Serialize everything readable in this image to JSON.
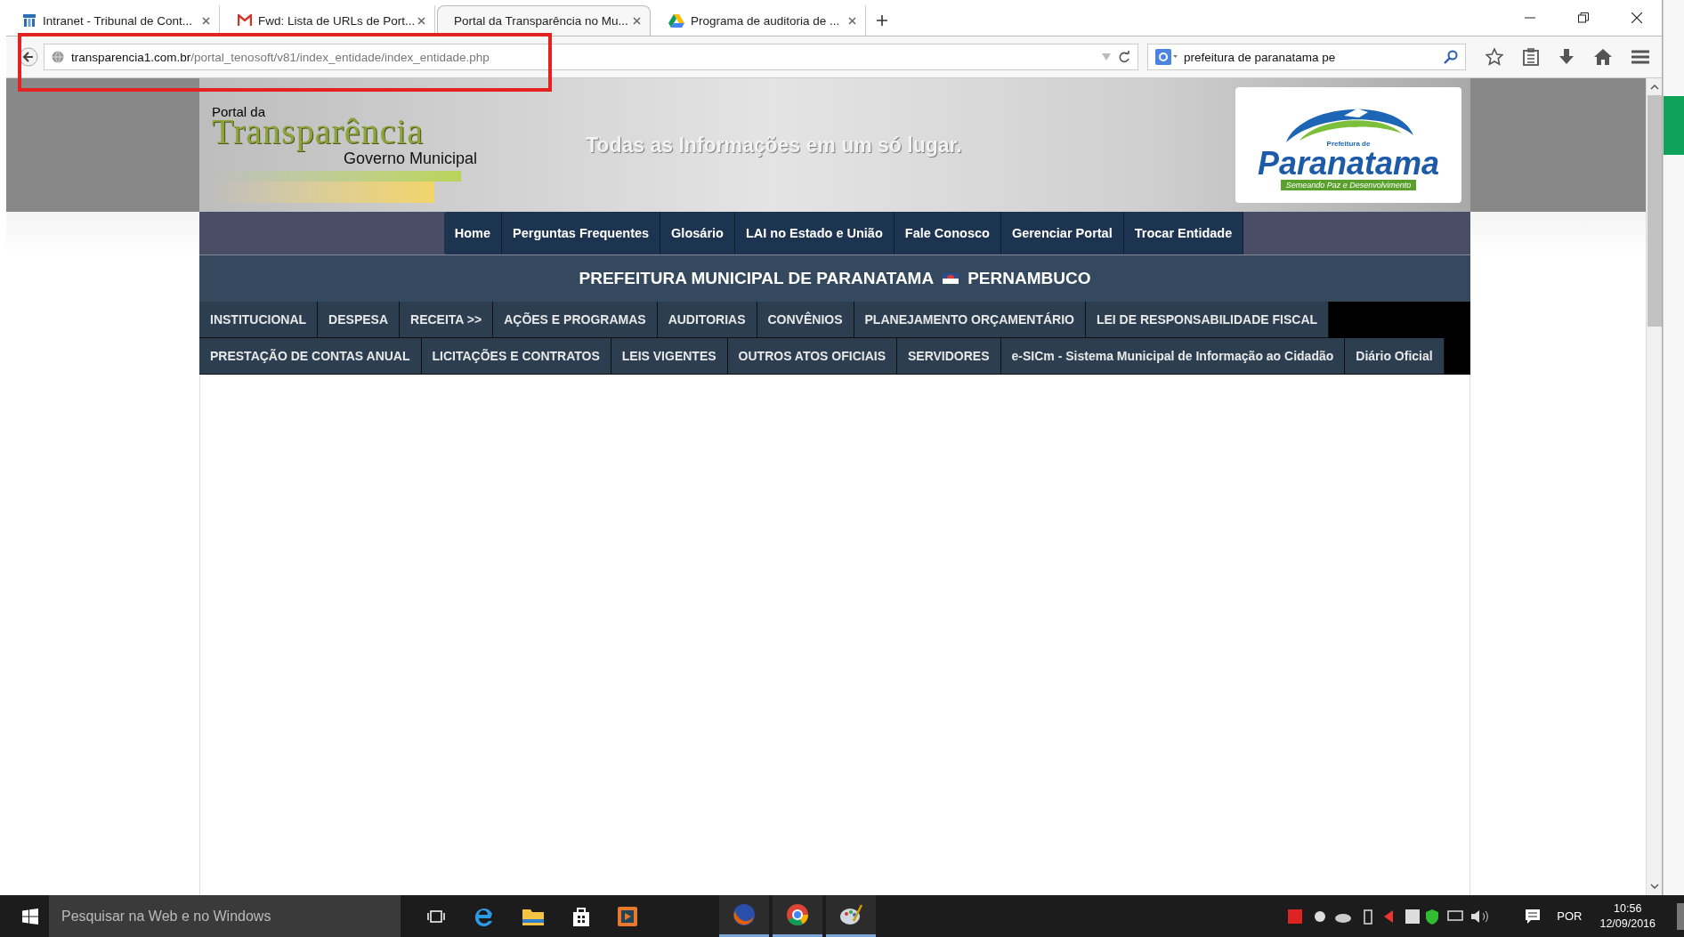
{
  "browser_tabs": [
    {
      "title": "Intranet - Tribunal de Cont...",
      "selected": false,
      "kind": "intranet"
    },
    {
      "title": "Fwd: Lista de URLs de Port...",
      "selected": false,
      "kind": "mail"
    },
    {
      "title": "Portal da Transparência no Mu...",
      "selected": true,
      "kind": "none"
    },
    {
      "title": "Programa de auditoria de ...",
      "selected": false,
      "kind": "drive"
    }
  ],
  "address_bar": {
    "host": "transparencia1.com.br",
    "path": "/portal_tenosoft/v81/index_entidade/index_entidade.php"
  },
  "search_box": {
    "value": "prefeitura de paranatama pe"
  },
  "header": {
    "small_title": "Portal da",
    "title": "Transparência",
    "subtitle": "Governo Municipal",
    "slogan": "Todas as Informações em um só lugar.",
    "logo_top": "Prefeitura de",
    "logo_name": "Paranatama",
    "logo_tagline": "Semeando Paz e Desenvolvimento"
  },
  "top_nav": [
    "Home",
    "Perguntas Frequentes",
    "Glosário",
    "LAI no Estado e União",
    "Fale Conosco",
    "Gerenciar Portal",
    "Trocar Entidade"
  ],
  "entity": {
    "name": "PREFEITURA MUNICIPAL DE PARANATAMA",
    "state": "PERNAMBUCO"
  },
  "menu_rows": [
    [
      "INSTITUCIONAL",
      "DESPESA",
      "RECEITA >>",
      "AÇÕES E PROGRAMAS",
      "AUDITORIAS",
      "CONVÊNIOS",
      "PLANEJAMENTO ORÇAMENTÁRIO",
      "LEI DE RESPONSABILIDADE FISCAL"
    ],
    [
      "PRESTAÇÃO DE CONTAS ANUAL",
      "LICITAÇÕES E CONTRATOS",
      "LEIS VIGENTES",
      "OUTROS ATOS OFICIAIS",
      "SERVIDORES",
      "e-SICm - Sistema Municipal de Informação ao Cidadão",
      "Diário Oficial"
    ]
  ],
  "taskbar": {
    "search_placeholder": "Pesquisar na Web e no Windows",
    "language": "POR",
    "time": "10:56",
    "date": "12/09/2016"
  }
}
